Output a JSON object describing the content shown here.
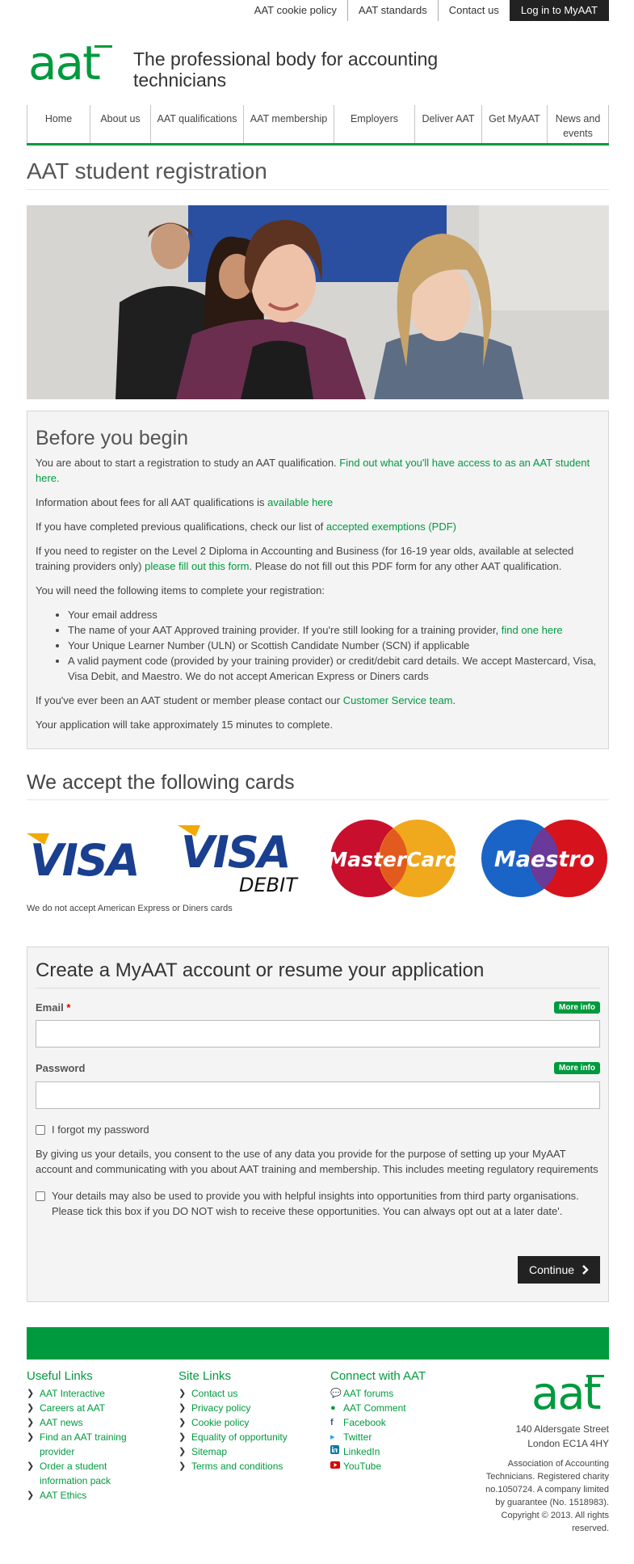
{
  "topbar": {
    "links": [
      "AAT cookie policy",
      "AAT standards",
      "Contact us"
    ],
    "login_label": "Log in to MyAAT"
  },
  "header": {
    "logo_text": "aat",
    "tagline": "The professional body for accounting technicians"
  },
  "nav": {
    "items": [
      "Home",
      "About us",
      "AAT qualifications",
      "AAT membership",
      "Employers",
      "Deliver AAT",
      "Get MyAAT",
      "News and events"
    ]
  },
  "page_title": "AAT student registration",
  "before": {
    "heading": "Before you begin",
    "p1_text": "You are about to start a registration to study an AAT qualification.",
    "p1_link": "Find out what you'll have access to as an AAT student here.",
    "p2_text": "Information about fees for all AAT qualifications is",
    "p2_link": "available here",
    "p3_text": "If you have completed previous qualifications, check our list of",
    "p3_link": "accepted exemptions (PDF)",
    "p4_text1": "If you need to register on the Level 2 Diploma in Accounting and Business (for 16-19 year olds, available at selected training providers only)",
    "p4_link": "please fill out this form",
    "p4_text2": ". Please do not fill out this PDF form for any other AAT qualification.",
    "p5_text": "You will need the following items to complete your registration:",
    "list": {
      "i1": "Your email address",
      "i2_text": "The name of your AAT Approved training provider. If you're still looking for a training provider,",
      "i2_link": "find one here",
      "i3": "Your Unique Learner Number (ULN) or Scottish Candidate Number (SCN) if applicable",
      "i4": "A valid payment code (provided by your training provider) or credit/debit card details. We accept Mastercard, Visa, Visa Debit, and Maestro. We do not accept American Express or Diners cards"
    },
    "p6_text": "If you've ever been an AAT student or member please contact our",
    "p6_link": "Customer Service team",
    "p6_end": ".",
    "p7_text": "Your application will take approximately 15 minutes to complete."
  },
  "cards": {
    "heading": "We accept the following cards",
    "visa": "VISA",
    "visa_debit": "VISA",
    "debit": "DEBIT",
    "mastercard": "MasterCard",
    "maestro": "Maestro",
    "note": "We do not accept American Express or Diners cards"
  },
  "form": {
    "heading": "Create a MyAAT account or resume your application",
    "email_label": "Email",
    "required_mark": "*",
    "more_info": "More info",
    "email_value": "",
    "password_label": "Password",
    "password_value": "",
    "forgot_label": "I forgot my password",
    "consent": "By giving us your details, you consent to the use of any data you provide for the purpose of setting up your MyAAT account and communicating with you about AAT training and membership. This includes meeting regulatory requirements",
    "third_party": "Your details may also be used to provide you with helpful insights into opportunities from third party organisations. Please tick this box if you DO NOT wish to receive these opportunities. You can always opt out at a later date'.",
    "continue_label": "Continue"
  },
  "footer": {
    "useful": {
      "heading": "Useful Links",
      "items": [
        "AAT Interactive",
        "Careers at AAT",
        "AAT news",
        "Find an AAT training provider",
        "Order a student information pack",
        "AAT Ethics"
      ]
    },
    "site": {
      "heading": "Site Links",
      "items": [
        "Contact us",
        "Privacy policy",
        "Cookie policy",
        "Equality of opportunity",
        "Sitemap",
        "Terms and conditions"
      ]
    },
    "connect": {
      "heading": "Connect with AAT",
      "items": [
        {
          "label": "AAT forums",
          "icon": "chat-icon"
        },
        {
          "label": "AAT Comment",
          "icon": "comment-icon"
        },
        {
          "label": "Facebook",
          "icon": "facebook-icon"
        },
        {
          "label": "Twitter",
          "icon": "twitter-icon"
        },
        {
          "label": "LinkedIn",
          "icon": "linkedin-icon"
        },
        {
          "label": "YouTube",
          "icon": "youtube-icon"
        }
      ]
    },
    "logo_text": "aat",
    "address_line1": "140 Aldersgate Street",
    "address_line2": "London EC1A 4HY",
    "legal": "Association of Accounting Technicians. Registered charity no.1050724. A company limited by guarantee (No. 1518983). Copyright © 2013. All rights reserved."
  },
  "colors": {
    "brand_green": "#009a3e",
    "dark": "#222222"
  }
}
